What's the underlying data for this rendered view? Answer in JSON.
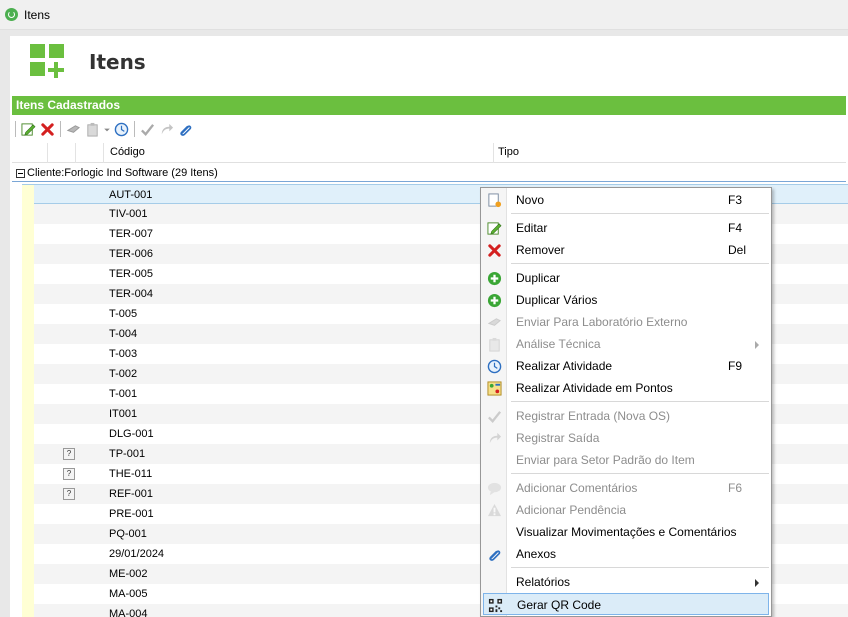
{
  "window": {
    "title": "Itens"
  },
  "header": {
    "title": "Itens"
  },
  "section": {
    "title": "Itens Cadastrados"
  },
  "grid": {
    "columns": [
      "Código",
      "Tipo"
    ],
    "group_label": "Cliente:Forlogic Ind Software (29 Itens)",
    "rows": [
      {
        "code": "AUT-001",
        "flag": ""
      },
      {
        "code": "TIV-001",
        "flag": ""
      },
      {
        "code": "TER-007",
        "flag": ""
      },
      {
        "code": "TER-006",
        "flag": ""
      },
      {
        "code": "TER-005",
        "flag": ""
      },
      {
        "code": "TER-004",
        "flag": ""
      },
      {
        "code": "T-005",
        "flag": ""
      },
      {
        "code": "T-004",
        "flag": ""
      },
      {
        "code": "T-003",
        "flag": ""
      },
      {
        "code": "T-002",
        "flag": ""
      },
      {
        "code": "T-001",
        "flag": ""
      },
      {
        "code": "IT001",
        "flag": ""
      },
      {
        "code": "DLG-001",
        "flag": ""
      },
      {
        "code": "TP-001",
        "flag": "?"
      },
      {
        "code": "THE-011",
        "flag": "?"
      },
      {
        "code": "REF-001",
        "flag": "?"
      },
      {
        "code": "PRE-001",
        "flag": ""
      },
      {
        "code": "PQ-001",
        "flag": ""
      },
      {
        "code": "29/01/2024",
        "flag": ""
      },
      {
        "code": "ME-002",
        "flag": ""
      },
      {
        "code": "MA-005",
        "flag": ""
      },
      {
        "code": "MA-004",
        "flag": ""
      }
    ]
  },
  "context_menu": {
    "items": [
      {
        "label": "Novo",
        "key": "F3",
        "icon": "new-document-icon",
        "enabled": true
      },
      {
        "label": "Editar",
        "key": "F4",
        "icon": "edit-icon",
        "enabled": true
      },
      {
        "label": "Remover",
        "key": "Del",
        "icon": "remove-icon",
        "enabled": true
      },
      {
        "label": "Duplicar",
        "key": "",
        "icon": "duplicate-icon",
        "enabled": true
      },
      {
        "label": "Duplicar Vários",
        "key": "",
        "icon": "duplicate-many-icon",
        "enabled": true
      },
      {
        "label": "Enviar Para Laboratório Externo",
        "key": "",
        "icon": "send-lab-icon",
        "enabled": false
      },
      {
        "label": "Análise Técnica",
        "key": "",
        "icon": "clipboard-icon",
        "enabled": false,
        "submenu": true
      },
      {
        "label": "Realizar Atividade",
        "key": "F9",
        "icon": "clock-icon",
        "enabled": true
      },
      {
        "label": "Realizar Atividade em Pontos",
        "key": "",
        "icon": "points-icon",
        "enabled": true
      },
      {
        "label": "Registrar Entrada (Nova OS)",
        "key": "",
        "icon": "checkmark-icon",
        "enabled": false
      },
      {
        "label": "Registrar Saída",
        "key": "",
        "icon": "forward-icon",
        "enabled": false
      },
      {
        "label": "Enviar para Setor Padrão do Item",
        "key": "",
        "icon": "",
        "enabled": false
      },
      {
        "label": "Adicionar Comentários",
        "key": "F6",
        "icon": "comment-icon",
        "enabled": false
      },
      {
        "label": "Adicionar Pendência",
        "key": "",
        "icon": "warning-icon",
        "enabled": false
      },
      {
        "label": "Visualizar Movimentações e Comentários",
        "key": "",
        "icon": "",
        "enabled": true
      },
      {
        "label": "Anexos",
        "key": "",
        "icon": "paperclip-icon",
        "enabled": true
      },
      {
        "label": "Relatórios",
        "key": "",
        "icon": "",
        "enabled": true,
        "submenu": true
      },
      {
        "label": "Gerar QR Code",
        "key": "",
        "icon": "qr-code-icon",
        "enabled": true,
        "hover": true
      }
    ]
  },
  "colors": {
    "accent_green": "#6bbf3f",
    "selection": "#e0f0fa",
    "hover": "#dbecf8"
  }
}
